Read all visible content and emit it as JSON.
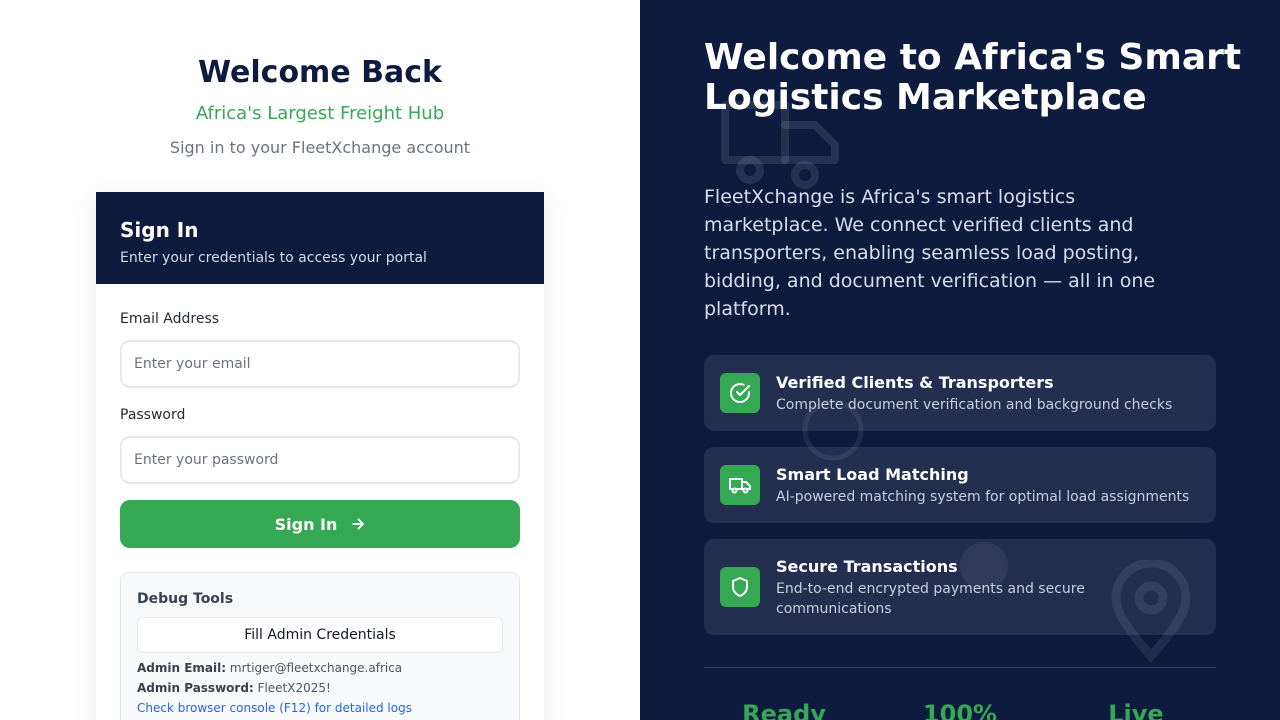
{
  "header": {
    "title": "Welcome Back",
    "tagline": "Africa's Largest Freight Hub",
    "subtitle": "Sign in to your FleetXchange account"
  },
  "signin_card": {
    "title": "Sign In",
    "description": "Enter your credentials to access your portal",
    "email_label": "Email Address",
    "email_placeholder": "Enter your email",
    "email_value": "",
    "password_label": "Password",
    "password_placeholder": "Enter your password",
    "password_value": "",
    "submit_label": "Sign In"
  },
  "debug": {
    "title": "Debug Tools",
    "fill_button": "Fill Admin Credentials",
    "admin_email_label": "Admin Email:",
    "admin_email": "mrtiger@fleetxchange.africa",
    "admin_password_label": "Admin Password:",
    "admin_password": "FleetX2025!",
    "console_link": "Check browser console (F12) for detailed logs"
  },
  "hero": {
    "title": "Welcome to Africa's Smart Logistics Marketplace",
    "description": "FleetXchange is Africa's smart logistics marketplace. We connect verified clients and transporters, enabling seamless load posting, bidding, and document verification — all in one platform."
  },
  "features": [
    {
      "icon": "check-circle-icon",
      "title": "Verified Clients & Transporters",
      "description": "Complete document verification and background checks"
    },
    {
      "icon": "truck-icon",
      "title": "Smart Load Matching",
      "description": "AI-powered matching system for optimal load assignments"
    },
    {
      "icon": "shield-icon",
      "title": "Secure Transactions",
      "description": "End-to-end encrypted payments and secure communications"
    }
  ],
  "stats": [
    {
      "value": "Ready"
    },
    {
      "value": "100%"
    },
    {
      "value": "Live"
    }
  ],
  "colors": {
    "navy": "#0d1b3e",
    "green": "#34a853",
    "link_blue": "#2563eb"
  }
}
